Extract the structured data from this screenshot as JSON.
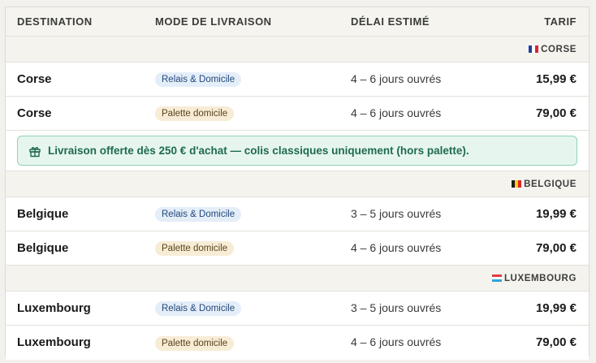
{
  "headers": {
    "destination": "DESTINATION",
    "mode": "MODE DE LIVRAISON",
    "delai": "DÉLAI ESTIMÉ",
    "tarif": "TARIF"
  },
  "groups": [
    {
      "label": "CORSE",
      "flag": "france-flag",
      "rows": [
        {
          "destination": "Corse",
          "mode": "Relais & Domicile",
          "delai": "4 – 6 jours ouvrés",
          "tarif": "15,99 €"
        },
        {
          "destination": "Corse",
          "mode": "Palette domicile",
          "delai": "4 – 6 jours ouvrés",
          "tarif": "79,00 €"
        }
      ],
      "promo": "Livraison offerte dès 250 € d'achat — colis classiques uniquement (hors palette)."
    },
    {
      "label": "BELGIQUE",
      "flag": "belgium-flag",
      "rows": [
        {
          "destination": "Belgique",
          "mode": "Relais & Domicile",
          "delai": "3 – 5 jours ouvrés",
          "tarif": "19,99 €"
        },
        {
          "destination": "Belgique",
          "mode": "Palette domicile",
          "delai": "4 – 6 jours ouvrés",
          "tarif": "79,00 €"
        }
      ]
    },
    {
      "label": "LUXEMBOURG",
      "flag": "luxembourg-flag",
      "rows": [
        {
          "destination": "Luxembourg",
          "mode": "Relais & Domicile",
          "delai": "3 – 5 jours ouvrés",
          "tarif": "19,99 €"
        },
        {
          "destination": "Luxembourg",
          "mode": "Palette domicile",
          "delai": "4 – 6 jours ouvrés",
          "tarif": "79,00 €"
        }
      ]
    }
  ],
  "colors": {
    "badge_relais": "#e4eef9",
    "badge_palette": "#f7ecd6",
    "promo_bg": "#e6f6ee",
    "promo_border": "#8fd3b6"
  },
  "icons": {
    "promo": "gift-icon"
  }
}
